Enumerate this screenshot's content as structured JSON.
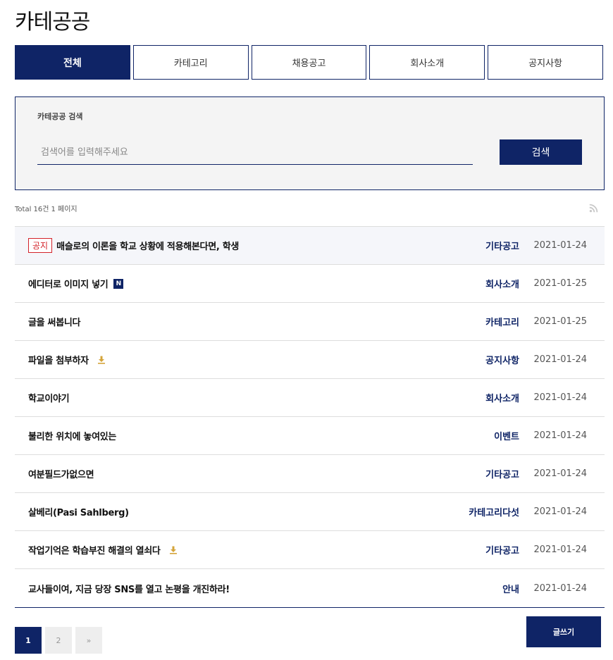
{
  "page": {
    "title": "카테공공"
  },
  "tabs": [
    {
      "label": "전체",
      "active": true
    },
    {
      "label": "카테고리"
    },
    {
      "label": "채용공고"
    },
    {
      "label": "회사소개"
    },
    {
      "label": "공지사항"
    }
  ],
  "search": {
    "label": "카테공공 검색",
    "placeholder": "검색어를 입력해주세요",
    "value": "",
    "button_label": "검색"
  },
  "summary": {
    "total_text": "Total 16건",
    "page_text": "1 페이지"
  },
  "icons": {
    "rss": "rss-icon",
    "file": "download-icon"
  },
  "colors": {
    "primary": "#0f2466",
    "notice": "#d3232a",
    "file_icon": "#d4a43a"
  },
  "posts": [
    {
      "badge": "공지",
      "subject": "매슬로의 이론을 학교 상황에 적용해본다면, 학생",
      "category": "기타공고",
      "date": "2021-01-24",
      "notice": true
    },
    {
      "subject": "에디터로 이미지 넣기",
      "new_badge": "N",
      "category": "회사소개",
      "date": "2021-01-25"
    },
    {
      "subject": "글을 써봅니다",
      "category": "카테고리",
      "date": "2021-01-25"
    },
    {
      "subject": "파일을 첨부하자",
      "has_file": true,
      "category": "공지사항",
      "date": "2021-01-24"
    },
    {
      "subject": "학교이야기",
      "category": "회사소개",
      "date": "2021-01-24"
    },
    {
      "subject": "불리한 위치에 놓여있는",
      "category": "이벤트",
      "date": "2021-01-24"
    },
    {
      "subject": "여분필드가없으면",
      "category": "기타공고",
      "date": "2021-01-24"
    },
    {
      "subject": "살베리(Pasi Sahlberg)",
      "category": "카테고리다섯",
      "date": "2021-01-24"
    },
    {
      "subject": "작업기억은 학습부진 해결의 열쇠다",
      "has_file": true,
      "category": "기타공고",
      "date": "2021-01-24"
    },
    {
      "subject": "교사들이여, 지금 당장 SNS를 열고 논평을 개진하라!",
      "category": "안내",
      "date": "2021-01-24"
    }
  ],
  "pagination": {
    "pages": [
      "1",
      "2"
    ],
    "current": "1",
    "next_icon": "»"
  },
  "write_button": {
    "label": "글쓰기"
  }
}
